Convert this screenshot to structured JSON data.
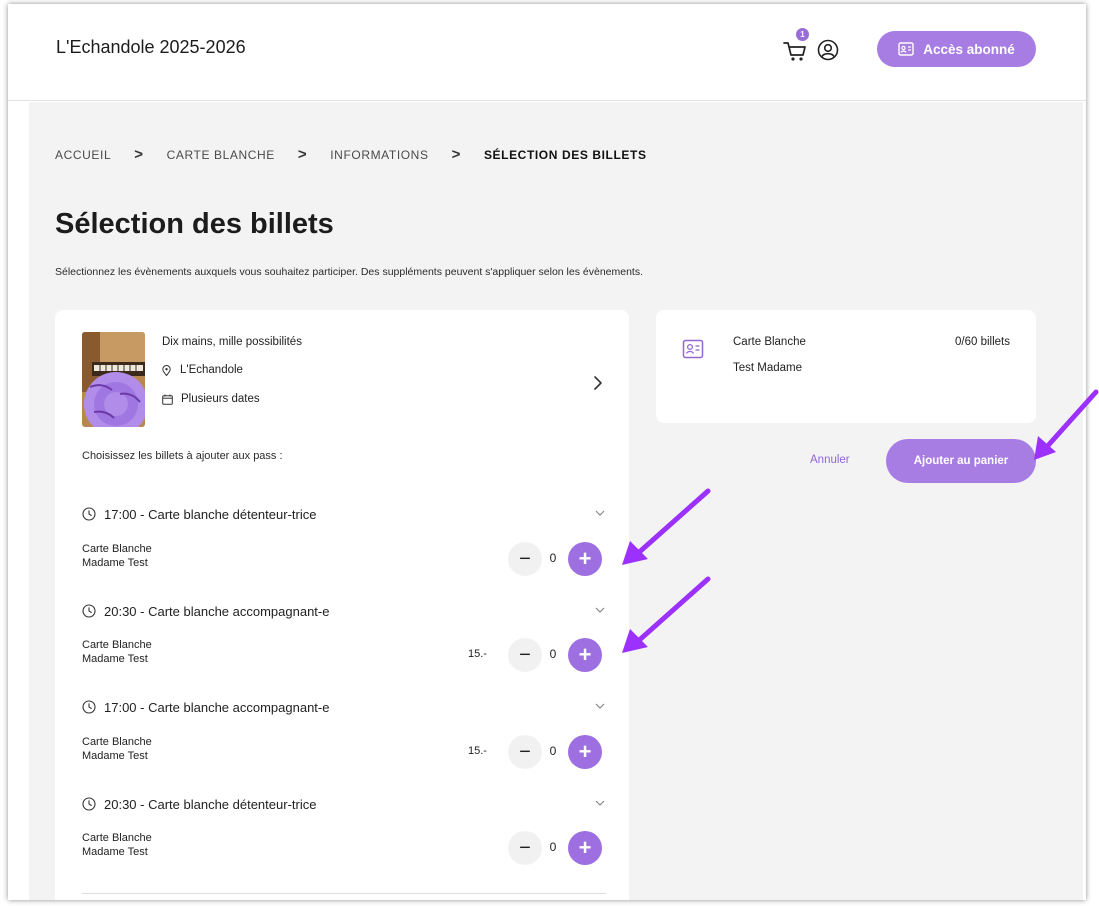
{
  "header": {
    "site_title": "L'Echandole 2025-2026",
    "cart_badge": "1",
    "subscriber_button": "Accès abonné"
  },
  "breadcrumb": {
    "items": [
      "ACCUEIL",
      "CARTE BLANCHE",
      "INFORMATIONS",
      "SÉLECTION DES BILLETS"
    ],
    "separator": ">"
  },
  "page": {
    "title": "Sélection des billets",
    "description": "Sélectionnez les évènements auxquels vous souhaitez participer. Des suppléments peuvent s'appliquer selon les évènements."
  },
  "event": {
    "name": "Dix mains, mille possibilités",
    "venue": "L'Echandole",
    "dates": "Plusieurs dates",
    "choose_label": "Choisissez les billets à ajouter aux pass :"
  },
  "groups": [
    {
      "title": "17:00 - Carte blanche détenteur-trice",
      "ticket_line1": "Carte Blanche",
      "ticket_line2": "Madame Test",
      "price": "",
      "quantity": "0"
    },
    {
      "title": "20:30 - Carte blanche accompagnant-e",
      "ticket_line1": "Carte Blanche",
      "ticket_line2": "Madame Test",
      "price": "15.-",
      "quantity": "0"
    },
    {
      "title": "17:00 - Carte blanche accompagnant-e",
      "ticket_line1": "Carte Blanche",
      "ticket_line2": "Madame Test",
      "price": "15.-",
      "quantity": "0"
    },
    {
      "title": "20:30 - Carte blanche détenteur-trice",
      "ticket_line1": "Carte Blanche",
      "ticket_line2": "Madame Test",
      "price": "",
      "quantity": "0"
    }
  ],
  "pass": {
    "name": "Carte Blanche",
    "holder": "Test Madame",
    "count": "0/60 billets"
  },
  "actions": {
    "cancel": "Annuler",
    "add_to_cart": "Ajouter au panier"
  },
  "colors": {
    "accent": "#a77de3",
    "arrow": "#9b30ff",
    "background": "#f3f3f3"
  },
  "icons": {
    "cart": "cart-icon",
    "user": "user-icon",
    "id_card": "id-card-icon",
    "location": "location-pin-icon",
    "calendar": "calendar-icon",
    "clock": "clock-icon",
    "chevron_right": "chevron-right-icon",
    "chevron_down": "chevron-down-icon",
    "minus": "minus-icon",
    "plus": "plus-icon"
  }
}
